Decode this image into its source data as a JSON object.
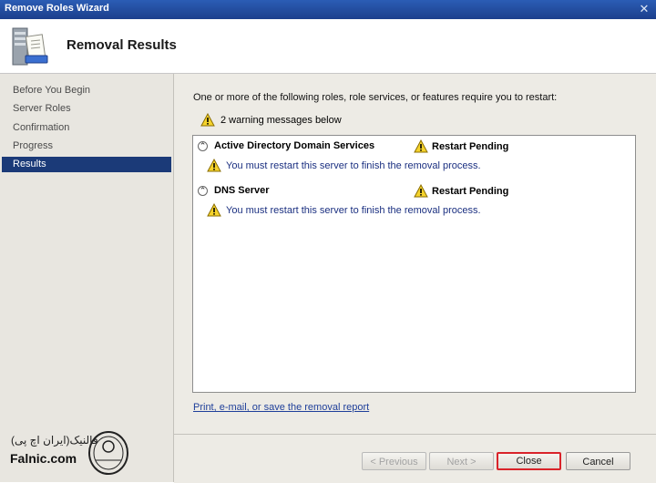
{
  "window": {
    "title": "Remove Roles Wizard",
    "close_glyph": "✕"
  },
  "header": {
    "title": "Removal Results",
    "icon": "server-roles-icon"
  },
  "nav": {
    "items": [
      {
        "label": "Before You Begin",
        "active": false
      },
      {
        "label": "Server Roles",
        "active": false
      },
      {
        "label": "Confirmation",
        "active": false
      },
      {
        "label": "Progress",
        "active": false
      },
      {
        "label": "Results",
        "active": true
      }
    ]
  },
  "main": {
    "intro": "One or more of the following roles, role services, or features require you to restart:",
    "summary": "2 warning messages below",
    "results": [
      {
        "role": "Active Directory Domain Services",
        "status": "Restart Pending",
        "message": "You must restart this server to finish the removal process."
      },
      {
        "role": "DNS Server",
        "status": "Restart Pending",
        "message": "You must restart this server to finish the removal process."
      }
    ],
    "report_link": "Print, e-mail, or save the removal report"
  },
  "footer": {
    "previous": "< Previous",
    "next": "Next >",
    "close": "Close",
    "cancel": "Cancel"
  },
  "watermark": {
    "fa": "فالنیک(ایران اچ پی)",
    "en": "Falnic.com",
    "seal": "iranhp.ir"
  },
  "colors": {
    "titlebar": "#2b5db5",
    "nav_active": "#1b3a78",
    "link": "#1f3f9a",
    "message": "#1a2f80",
    "close_highlight": "#d9232a"
  }
}
